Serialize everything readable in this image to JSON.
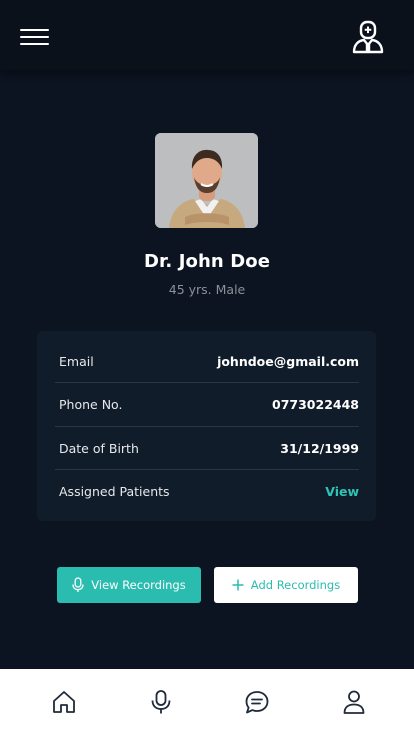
{
  "header": {
    "menu_icon": "hamburger-menu-icon",
    "doctor_icon": "doctor-icon"
  },
  "profile": {
    "name": "Dr. John Doe",
    "meta": "45 yrs. Male",
    "avatar_icon": "profile-photo"
  },
  "details": [
    {
      "label": "Email",
      "value": "johndoe@gmail.com"
    },
    {
      "label": "Phone No.",
      "value": "0773022448"
    },
    {
      "label": "Date of Birth",
      "value": "31/12/1999"
    },
    {
      "label": "Assigned Patients",
      "value": "View"
    }
  ],
  "actions": {
    "view_recordings": "View Recordings",
    "add_recordings": "Add Recordings"
  },
  "nav": [
    "home-icon",
    "microphone-icon",
    "chat-icon",
    "user-icon"
  ],
  "colors": {
    "background": "#0d1421",
    "card": "#111c2b",
    "accent": "#2bbcb0",
    "nav_icon": "#1f2a3a"
  }
}
